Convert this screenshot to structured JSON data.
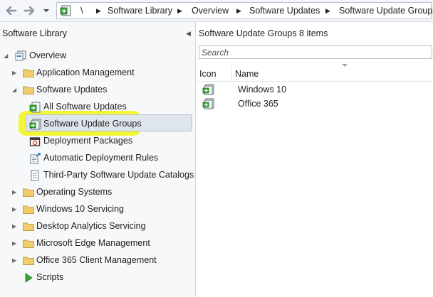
{
  "address_bar": {
    "root_separator": "\\",
    "crumbs": [
      "Software Library",
      "Overview",
      "Software Updates",
      "Software Update Groups"
    ],
    "separator_glyph": "▶"
  },
  "left_pane": {
    "title": "Software Library",
    "tree": [
      {
        "label": "Overview",
        "icon": "overview-icon",
        "expander": "◢"
      },
      {
        "label": "Application Management",
        "icon": "folder-icon",
        "expander": "▶"
      },
      {
        "label": "Software Updates",
        "icon": "folder-icon",
        "expander": "◢"
      },
      {
        "label": "All Software Updates",
        "icon": "software-update-icon"
      },
      {
        "label": "Software Update Groups",
        "icon": "software-update-group-icon",
        "selected": true
      },
      {
        "label": "Deployment Packages",
        "icon": "deployment-package-icon"
      },
      {
        "label": "Automatic Deployment Rules",
        "icon": "deployment-rule-icon"
      },
      {
        "label": "Third-Party Software Update Catalogs",
        "icon": "catalog-icon"
      },
      {
        "label": "Operating Systems",
        "icon": "folder-icon",
        "expander": "▶"
      },
      {
        "label": "Windows 10 Servicing",
        "icon": "folder-icon",
        "expander": "▶"
      },
      {
        "label": "Desktop Analytics Servicing",
        "icon": "folder-icon",
        "expander": "▶"
      },
      {
        "label": "Microsoft Edge Management",
        "icon": "folder-icon",
        "expander": "▶"
      },
      {
        "label": "Office 365 Client Management",
        "icon": "folder-icon",
        "expander": "▶"
      },
      {
        "label": "Scripts",
        "icon": "script-run-icon"
      }
    ]
  },
  "right_pane": {
    "title": "Software Update Groups 8 items",
    "search_placeholder": "Search",
    "columns": {
      "icon": "Icon",
      "name": "Name"
    },
    "rows": [
      {
        "name": "Windows 10",
        "icon": "software-update-group-icon"
      },
      {
        "name": "Office 365",
        "icon": "software-update-group-icon"
      }
    ]
  },
  "colors": {
    "highlight": "#f2f500",
    "selection": "#dfe5ec",
    "folder": "#e8c25a",
    "update_green": "#3aa53a"
  }
}
